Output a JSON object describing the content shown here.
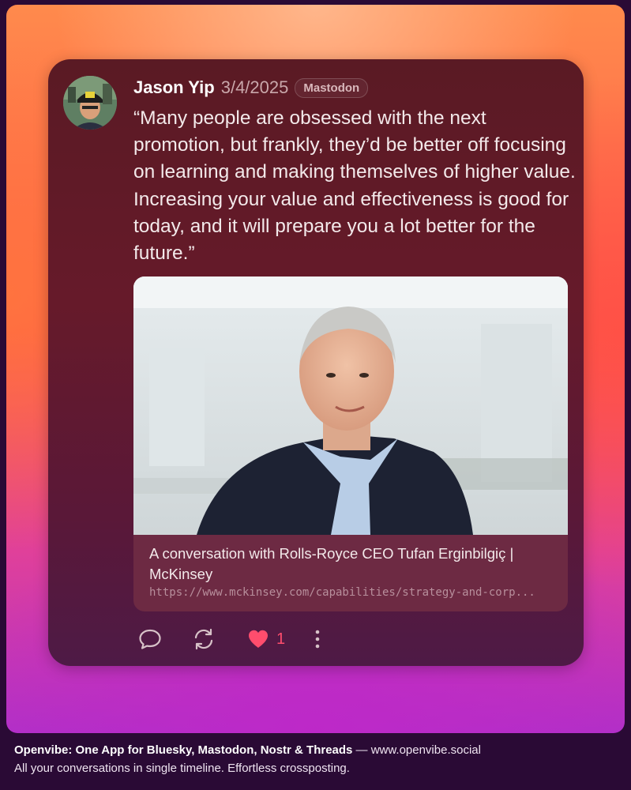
{
  "post": {
    "author": "Jason Yip",
    "date": "3/4/2025",
    "platform": "Mastodon",
    "text": "“Many people are obsessed with the next promotion, but frankly, they’d be better off focusing on learning and making themselves of higher value. Increasing your value and effectiveness is good for today, and it will prepare you a lot better for the future.”"
  },
  "link_card": {
    "title": "A conversation with Rolls-Royce CEO Tufan Erginbilgiç | McKinsey",
    "url": "https://www.mckinsey.com/capabilities/strategy-and-corp..."
  },
  "actions": {
    "reply_icon": "speech-bubble-icon",
    "repost_icon": "repost-icon",
    "like_icon": "heart-icon",
    "like_count": "1",
    "more_icon": "more-vertical-icon"
  },
  "footer": {
    "tagline_bold": "Openvibe: One App for Bluesky, Mastodon, Nostr & Threads",
    "tagline_rest": " — www.openvibe.social",
    "subline": "All your conversations in single timeline. Effortless crossposting."
  },
  "colors": {
    "card_bg": "#611a2a",
    "like_color": "#ff4d6d",
    "text_primary": "#f3e9ea"
  }
}
